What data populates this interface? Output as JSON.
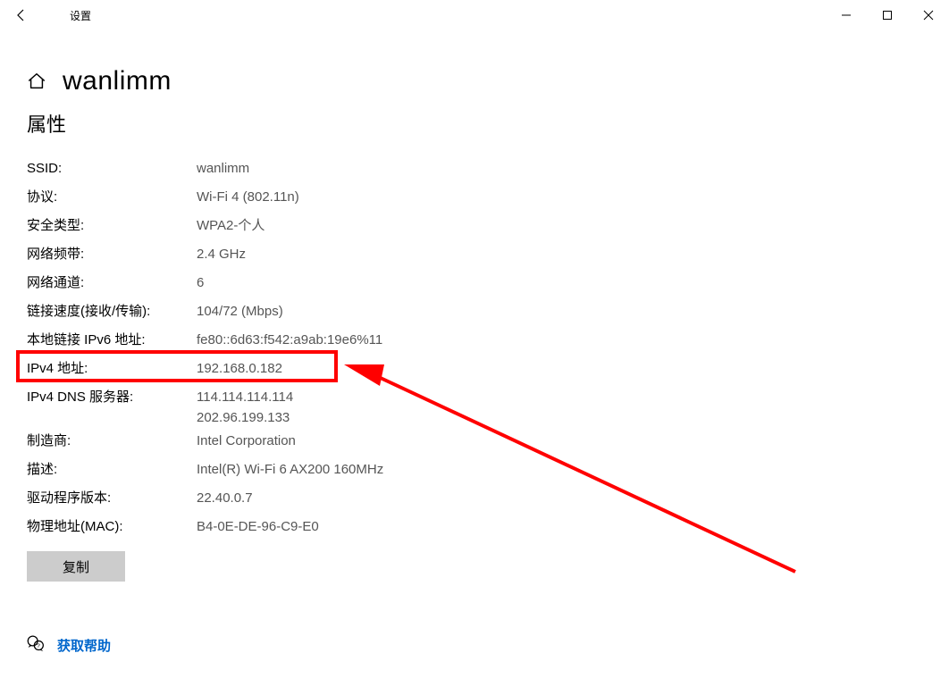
{
  "window": {
    "title": "设置"
  },
  "heading": {
    "title": "wanlimm"
  },
  "section": {
    "properties_title": "属性"
  },
  "props": {
    "ssid": {
      "label": "SSID:",
      "value": "wanlimm"
    },
    "protocol": {
      "label": "协议:",
      "value": "Wi-Fi 4 (802.11n)"
    },
    "security": {
      "label": "安全类型:",
      "value": "WPA2-个人"
    },
    "band": {
      "label": "网络频带:",
      "value": "2.4 GHz"
    },
    "channel": {
      "label": "网络通道:",
      "value": "6"
    },
    "speed": {
      "label": "链接速度(接收/传输):",
      "value": "104/72 (Mbps)"
    },
    "ipv6_local": {
      "label": "本地链接 IPv6 地址:",
      "value": "fe80::6d63:f542:a9ab:19e6%11"
    },
    "ipv4": {
      "label": "IPv4 地址:",
      "value": "192.168.0.182"
    },
    "ipv4_dns": {
      "label": "IPv4 DNS 服务器:",
      "value": "114.114.114.114\n202.96.199.133"
    },
    "manufacturer": {
      "label": "制造商:",
      "value": "Intel Corporation"
    },
    "description": {
      "label": "描述:",
      "value": "Intel(R) Wi-Fi 6 AX200 160MHz"
    },
    "driver_ver": {
      "label": "驱动程序版本:",
      "value": "22.40.0.7"
    },
    "mac": {
      "label": "物理地址(MAC):",
      "value": "B4-0E-DE-96-C9-E0"
    }
  },
  "buttons": {
    "copy": "复制"
  },
  "help": {
    "link": "获取帮助"
  }
}
